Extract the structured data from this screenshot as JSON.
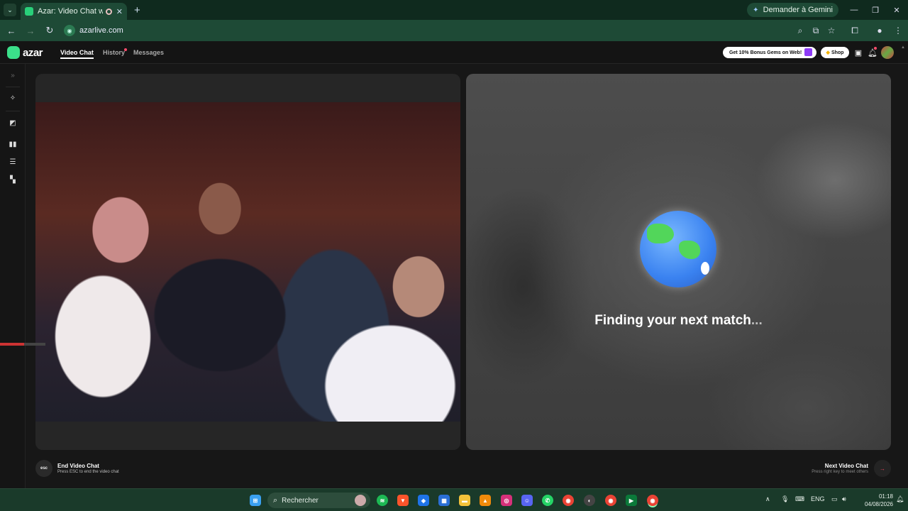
{
  "browser": {
    "tab_title": "Azar: Video Chat with New",
    "new_tab": "+",
    "gemini_label": "Demander à Gemini",
    "url": "azarlive.com"
  },
  "app": {
    "logo": "azar",
    "nav": [
      {
        "label": "Video Chat"
      },
      {
        "label": "History"
      },
      {
        "label": "Messages"
      }
    ],
    "promo_label": "Get 10% Bonus Gems on Web!",
    "shop_label": "Shop"
  },
  "status": {
    "finding": "Finding your next match",
    "ellipsis": "..."
  },
  "controls": {
    "esc_key": "esc",
    "end_title": "End Video Chat",
    "end_sub": "Press ESC to end the video chat",
    "next_title": "Next Video Chat",
    "next_sub": "Press right key to meet others"
  },
  "taskbar": {
    "search_placeholder": "Rechercher",
    "lang": "ENG",
    "time": "01:18",
    "date": "04/08/2026"
  },
  "colors": {
    "accent": "#3be08a",
    "notification": "#ff4d6d",
    "promo_gift": "#8e3cf7"
  }
}
